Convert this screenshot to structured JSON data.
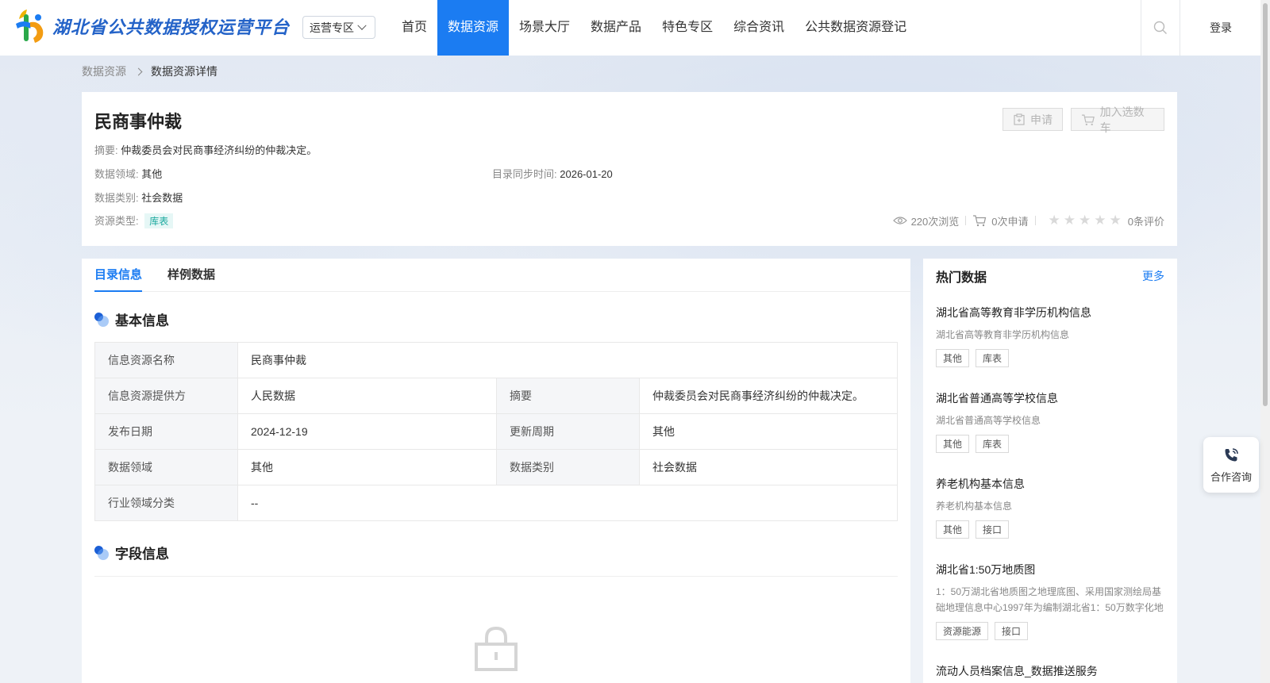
{
  "header": {
    "logo_text": "湖北省公共数据授权运营平台",
    "zone_select": "运营专区",
    "nav": [
      "首页",
      "数据资源",
      "场景大厅",
      "数据产品",
      "特色专区",
      "综合资讯",
      "公共数据资源登记"
    ],
    "active_nav_index": 1,
    "login": "登录"
  },
  "breadcrumb": {
    "parent": "数据资源",
    "current": "数据资源详情"
  },
  "summary": {
    "title": "民商事仲裁",
    "abstract_label": "摘要:",
    "abstract": "仲裁委员会对民商事经济纠纷的仲裁决定。",
    "domain_label": "数据领域:",
    "domain": "其他",
    "sync_label": "目录同步时间:",
    "sync_time": "2026-01-20",
    "category_label": "数据类别:",
    "category": "社会数据",
    "type_label": "资源类型:",
    "type_tag": "库表",
    "apply_btn": "申请",
    "cart_btn": "加入选数车",
    "views": "220次浏览",
    "applies": "0次申请",
    "rating": 0,
    "reviews": "0条评价"
  },
  "tabs": [
    "目录信息",
    "样例数据"
  ],
  "basic": {
    "title": "基本信息",
    "rows": [
      {
        "k1": "信息资源名称",
        "v1": "民商事仲裁"
      },
      {
        "k1": "信息资源提供方",
        "v1": "人民数据",
        "k2": "摘要",
        "v2": "仲裁委员会对民商事经济纠纷的仲裁决定。"
      },
      {
        "k1": "发布日期",
        "v1": "2024-12-19",
        "k2": "更新周期",
        "v2": "其他"
      },
      {
        "k1": "数据领域",
        "v1": "其他",
        "k2": "数据类别",
        "v2": "社会数据"
      },
      {
        "k1": "行业领域分类",
        "v1": "--"
      }
    ]
  },
  "fields": {
    "title": "字段信息"
  },
  "hot": {
    "title": "热门数据",
    "more": "更多",
    "items": [
      {
        "title": "湖北省高等教育非学历机构信息",
        "desc": "湖北省高等教育非学历机构信息",
        "tags": [
          "其他",
          "库表"
        ]
      },
      {
        "title": "湖北省普通高等学校信息",
        "desc": "湖北省普通高等学校信息",
        "tags": [
          "其他",
          "库表"
        ]
      },
      {
        "title": "养老机构基本信息",
        "desc": "养老机构基本信息",
        "tags": [
          "其他",
          "接口"
        ]
      },
      {
        "title": "湖北省1:50万地质图",
        "desc": "1：50万湖北省地质图之地理底图、采用国家测绘局基础地理信息中心1997年为编制湖北省1：50万数字化地",
        "tags": [
          "资源能源",
          "接口"
        ]
      },
      {
        "title": "流动人员档案信息_数据推送服务"
      }
    ]
  },
  "consult": "合作咨询"
}
